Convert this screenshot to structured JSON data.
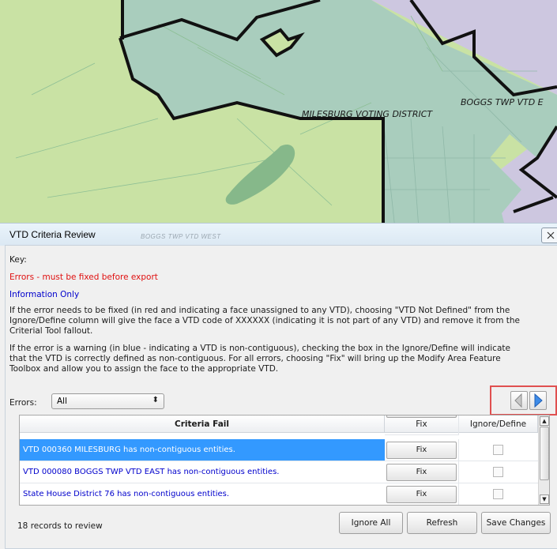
{
  "map": {
    "labels": {
      "milesburg": "MILESBURG VOTING DISTRICT",
      "boggs": "BOGGS TWP VTD E"
    }
  },
  "dialog": {
    "title": "VTD Criteria Review",
    "ghost_label": "BOGGS TWP VTD WEST",
    "close_icon": "close-icon",
    "key_label": "Key:",
    "errors_key": "Errors - must be fixed before export",
    "info_key": "Information Only",
    "paragraph1": [
      "If the error needs to be fixed (in red and indicating a face unassigned to any VTD), choosing \"VTD Not Defined\" from the",
      "Ignore/Define column will give the face a VTD code of XXXXXX (indicating it is not part of any VTD) and remove it from the",
      "Criterial Tool fallout."
    ],
    "paragraph2": [
      "If the error is a warning (in blue - indicating a VTD is non-contiguous), checking the box in the Ignore/Define will indicate",
      "that the VTD is correctly defined as non-contiguous. For all errors, choosing \"Fix\" will bring up the Modify Area Feature",
      "Toolbox and allow you to assign the face to the appropriate VTD."
    ],
    "errors_filter": {
      "label": "Errors:",
      "value": "All"
    },
    "nav": {
      "prev_icon": "triangle-left-icon",
      "next_icon": "triangle-right-icon"
    },
    "table": {
      "columns": [
        "Criteria Fail",
        "Fix",
        "Ignore/Define"
      ],
      "rows": [
        {
          "text": "VTD 000360 MILESBURG has non-contiguous entities.",
          "fix": "Fix",
          "selected": true
        },
        {
          "text": "VTD 000080 BOGGS TWP VTD EAST has non-contiguous entities.",
          "fix": "Fix",
          "selected": false
        },
        {
          "text": "State House District 76 has non-contiguous entities.",
          "fix": "Fix",
          "selected": false
        }
      ]
    },
    "records": "18 records to review",
    "buttons": {
      "ignore_all": "Ignore All",
      "refresh": "Refresh",
      "save": "Save Changes"
    },
    "colors": {
      "error": "#e01010",
      "info": "#0000cc",
      "selection": "#3399ff"
    }
  }
}
